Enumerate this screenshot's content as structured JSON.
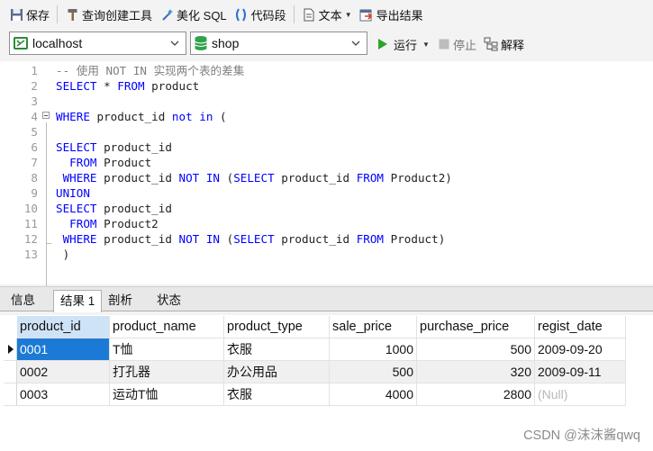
{
  "toolbar": {
    "save": "保存",
    "query_builder": "查询创建工具",
    "beautify": "美化 SQL",
    "snippet": "代码段",
    "text": "文本",
    "export": "导出结果"
  },
  "connection": {
    "value": "localhost"
  },
  "database": {
    "value": "shop"
  },
  "actions": {
    "run": "运行",
    "stop": "停止",
    "explain": "解释"
  },
  "editor": {
    "lines": [
      {
        "n": "1",
        "tokens": [
          {
            "t": "-- 使用 NOT IN 实现两个表的差集",
            "c": "cm"
          }
        ]
      },
      {
        "n": "2",
        "tokens": [
          {
            "t": "SELECT",
            "c": "kw"
          },
          {
            "t": " * ",
            "c": "tx"
          },
          {
            "t": "FROM",
            "c": "kw"
          },
          {
            "t": " product",
            "c": "tx"
          }
        ]
      },
      {
        "n": "3",
        "tokens": []
      },
      {
        "n": "4",
        "tokens": [
          {
            "t": "WHERE",
            "c": "kw"
          },
          {
            "t": " product_id ",
            "c": "tx"
          },
          {
            "t": "not in",
            "c": "kw"
          },
          {
            "t": " (",
            "c": "tx"
          }
        ]
      },
      {
        "n": "5",
        "tokens": []
      },
      {
        "n": "6",
        "tokens": [
          {
            "t": "SELECT",
            "c": "kw"
          },
          {
            "t": " product_id",
            "c": "tx"
          }
        ]
      },
      {
        "n": "7",
        "tokens": [
          {
            "t": "  ",
            "c": "tx"
          },
          {
            "t": "FROM",
            "c": "kw"
          },
          {
            "t": " Product",
            "c": "tx"
          }
        ]
      },
      {
        "n": "8",
        "tokens": [
          {
            "t": " ",
            "c": "tx"
          },
          {
            "t": "WHERE",
            "c": "kw"
          },
          {
            "t": " product_id ",
            "c": "tx"
          },
          {
            "t": "NOT IN",
            "c": "kw"
          },
          {
            "t": " (",
            "c": "tx"
          },
          {
            "t": "SELECT",
            "c": "kw"
          },
          {
            "t": " product_id ",
            "c": "tx"
          },
          {
            "t": "FROM",
            "c": "kw"
          },
          {
            "t": " Product2)",
            "c": "tx"
          }
        ]
      },
      {
        "n": "9",
        "tokens": [
          {
            "t": "UNION",
            "c": "kw"
          }
        ]
      },
      {
        "n": "10",
        "tokens": [
          {
            "t": "SELECT",
            "c": "kw"
          },
          {
            "t": " product_id",
            "c": "tx"
          }
        ]
      },
      {
        "n": "11",
        "tokens": [
          {
            "t": "  ",
            "c": "tx"
          },
          {
            "t": "FROM",
            "c": "kw"
          },
          {
            "t": " Product2",
            "c": "tx"
          }
        ]
      },
      {
        "n": "12",
        "tokens": [
          {
            "t": " ",
            "c": "tx"
          },
          {
            "t": "WHERE",
            "c": "kw"
          },
          {
            "t": " product_id ",
            "c": "tx"
          },
          {
            "t": "NOT IN",
            "c": "kw"
          },
          {
            "t": " (",
            "c": "tx"
          },
          {
            "t": "SELECT",
            "c": "kw"
          },
          {
            "t": " product_id ",
            "c": "tx"
          },
          {
            "t": "FROM",
            "c": "kw"
          },
          {
            "t": " Product)",
            "c": "tx"
          }
        ]
      },
      {
        "n": "13",
        "tokens": [
          {
            "t": " )",
            "c": "tx"
          }
        ]
      }
    ]
  },
  "tabs": [
    {
      "label": "信息",
      "active": false
    },
    {
      "label": "结果 1",
      "active": true
    },
    {
      "label": "剖析",
      "active": false
    },
    {
      "label": "状态",
      "active": false
    }
  ],
  "grid": {
    "columns": [
      "product_id",
      "product_name",
      "product_type",
      "sale_price",
      "purchase_price",
      "regist_date"
    ],
    "rows": [
      [
        "0001",
        "T恤",
        "衣服",
        "1000",
        "500",
        "2009-09-20"
      ],
      [
        "0002",
        "打孔器",
        "办公用品",
        "500",
        "320",
        "2009-09-11"
      ],
      [
        "0003",
        "运动T恤",
        "衣服",
        "4000",
        "2800",
        "(Null)"
      ]
    ],
    "selected_row": 0
  },
  "watermark": "CSDN @沫沫酱qwq",
  "colors": {
    "keyword": "#0000ff",
    "comment": "#808080",
    "selection": "#1c7ad6"
  }
}
